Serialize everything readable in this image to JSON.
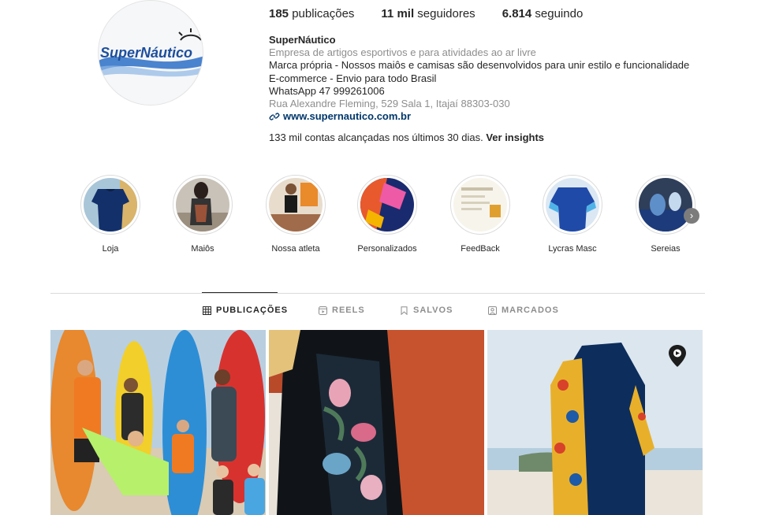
{
  "profile": {
    "logo_text": "SuperNáutico",
    "stats": {
      "posts_count": "185",
      "posts_label": "publicações",
      "followers_count": "11 mil",
      "followers_label": "seguidores",
      "following_count": "6.814",
      "following_label": "seguindo"
    },
    "bio": {
      "name": "SuperNáutico",
      "category": "Empresa de artigos esportivos e para atividades ao ar livre",
      "line1": "Marca própria - Nossos maiôs e camisas são desenvolvidos para unir estilo e funcionalidade",
      "line2": "E-commerce - Envio para todo Brasil",
      "line3": "WhatsApp 47 999261006",
      "address": "Rua Alexandre Fleming, 529 Sala 1, Itajaí 88303-030",
      "website": "www.supernautico.com.br"
    },
    "insights": {
      "text": "133 mil contas alcançadas nos últimos 30 dias.",
      "link": "Ver insights"
    }
  },
  "highlights": [
    {
      "label": "Loja",
      "icon": "navy-lycra-shirt"
    },
    {
      "label": "Maiôs",
      "icon": "woman-swimsuit"
    },
    {
      "label": "Nossa atleta",
      "icon": "athlete"
    },
    {
      "label": "Personalizados",
      "icon": "custom-prints"
    },
    {
      "label": "FeedBack",
      "icon": "feedback-message"
    },
    {
      "label": "Lycras Masc",
      "icon": "mens-lycra"
    },
    {
      "label": "Sereias",
      "icon": "mermaids"
    }
  ],
  "tabs": [
    {
      "label": "PUBLICAÇÕES",
      "icon": "grid-icon",
      "active": true
    },
    {
      "label": "REELS",
      "icon": "reels-icon",
      "active": false
    },
    {
      "label": "SALVOS",
      "icon": "bookmark-icon",
      "active": false
    },
    {
      "label": "MARCADOS",
      "icon": "tagged-icon",
      "active": false
    }
  ],
  "posts": [
    {
      "subject": "group-with-surfboards-on-beach"
    },
    {
      "subject": "floral-long-sleeve-swimsuit-closeup"
    },
    {
      "subject": "navy-floral-long-sleeve-swimsuit-beach",
      "badge": "reel-icon"
    }
  ],
  "colors": {
    "link": "#00376b",
    "muted": "#8e8e8e",
    "text": "#262626",
    "brand_blue": "#1d4f9c"
  }
}
